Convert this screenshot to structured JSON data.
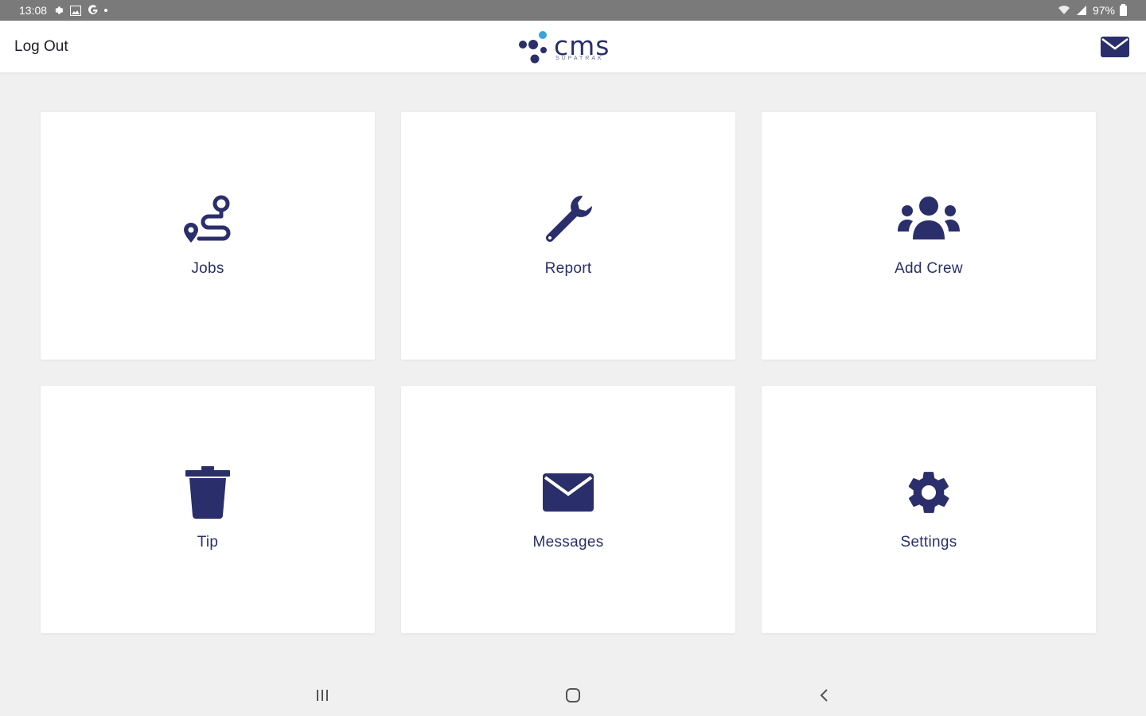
{
  "status_bar": {
    "time": "13:08",
    "battery": "97%"
  },
  "header": {
    "logout_label": "Log Out",
    "logo_text": "cms",
    "logo_subtext": "SUPATRAK",
    "mail_icon": "envelope-icon"
  },
  "tiles": [
    {
      "label": "Jobs",
      "icon": "route-icon"
    },
    {
      "label": "Report",
      "icon": "wrench-icon"
    },
    {
      "label": "Add Crew",
      "icon": "users-icon"
    },
    {
      "label": "Tip",
      "icon": "trash-icon"
    },
    {
      "label": "Messages",
      "icon": "envelope-icon"
    },
    {
      "label": "Settings",
      "icon": "gear-icon"
    }
  ],
  "colors": {
    "brand": "#2a2f6b",
    "background": "#f0f0f0",
    "tile": "#ffffff",
    "status_bar": "#7a7a7a"
  },
  "nav_bar": {
    "recent_icon": "recent-apps-icon",
    "home_icon": "home-icon",
    "back_icon": "back-icon"
  }
}
